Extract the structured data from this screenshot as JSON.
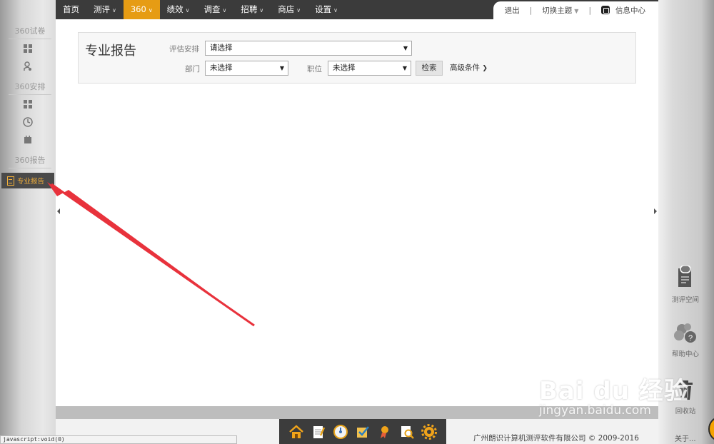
{
  "nav": {
    "items": [
      {
        "label": "首页",
        "has_caret": false,
        "active": false
      },
      {
        "label": "测评",
        "has_caret": true,
        "active": false
      },
      {
        "label": "360",
        "has_caret": true,
        "active": true
      },
      {
        "label": "绩效",
        "has_caret": true,
        "active": false
      },
      {
        "label": "调查",
        "has_caret": true,
        "active": false
      },
      {
        "label": "招聘",
        "has_caret": true,
        "active": false
      },
      {
        "label": "商店",
        "has_caret": true,
        "active": false
      },
      {
        "label": "设置",
        "has_caret": true,
        "active": false
      }
    ],
    "caret": "∨",
    "logout": "退出",
    "switch_theme": "切换主题",
    "message_center": "信息中心"
  },
  "sidebar": {
    "section1": "360试卷",
    "section2": "360安排",
    "section3": "360报告",
    "active_item": "专业报告"
  },
  "panel": {
    "title": "专业报告",
    "label_plan": "评估安排",
    "plan_value": "请选择",
    "label_dept": "部门",
    "dept_value": "未选择",
    "label_position": "职位",
    "position_value": "未选择",
    "search_button": "检索",
    "advanced": "高级条件"
  },
  "right_widgets": {
    "space": "测评空间",
    "help": "帮助中心",
    "recycle": "回收站",
    "about": "关于..."
  },
  "footer": {
    "copyright": "广州朗识计算机测评软件有限公司 © 2009-2016",
    "status": "javascript:void(0)"
  },
  "watermark": {
    "logo": "Bai du 经验",
    "url": "jingyan.baidu.com"
  },
  "colors": {
    "accent": "#e69c14",
    "nav_bg": "#3b3b3b",
    "arrow": "#e8323c"
  }
}
